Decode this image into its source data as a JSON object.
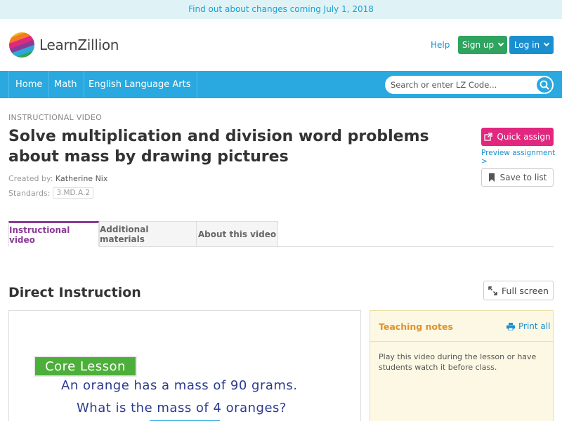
{
  "banner": {
    "text": "Find out about changes coming July 1, 2018"
  },
  "header": {
    "logo_text": "LearnZillion",
    "help": "Help",
    "signup": "Sign up",
    "login": "Log in"
  },
  "nav": {
    "items": [
      {
        "label": "Home"
      },
      {
        "label": "Math"
      },
      {
        "label": "English Language Arts"
      }
    ],
    "search_placeholder": "Search or enter LZ Code..."
  },
  "lesson": {
    "eyebrow": "INSTRUCTIONAL VIDEO",
    "title": "Solve multiplication and division word problems about mass by drawing pictures",
    "created_label": "Created by:",
    "created_by": "Katherine Nix",
    "standards_label": "Standards:",
    "standard": "3.MD.A.2",
    "quick_assign": "Quick assign",
    "preview": "Preview assignment >",
    "save": "Save to list"
  },
  "tabs": [
    {
      "label": "Instructional video",
      "active": true
    },
    {
      "label": "Additional materials",
      "active": false
    },
    {
      "label": "About this video",
      "active": false
    }
  ],
  "instruction": {
    "title": "Direct Instruction",
    "fullscreen": "Full screen",
    "video": {
      "badge": "Core Lesson",
      "line1": "An orange has a mass of 90 grams.",
      "line2": "What is the mass of 4 oranges?"
    },
    "notes": {
      "title": "Teaching notes",
      "print": "Print all",
      "body": "Play this video during the lesson or have students watch it before class."
    }
  },
  "colors": {
    "nav": "#29a9e0",
    "signup": "#2fa360",
    "login": "#1a8fd0",
    "quick_assign": "#e1277f",
    "active_tab": "#8b3a96",
    "notes_title": "#e0912b"
  }
}
